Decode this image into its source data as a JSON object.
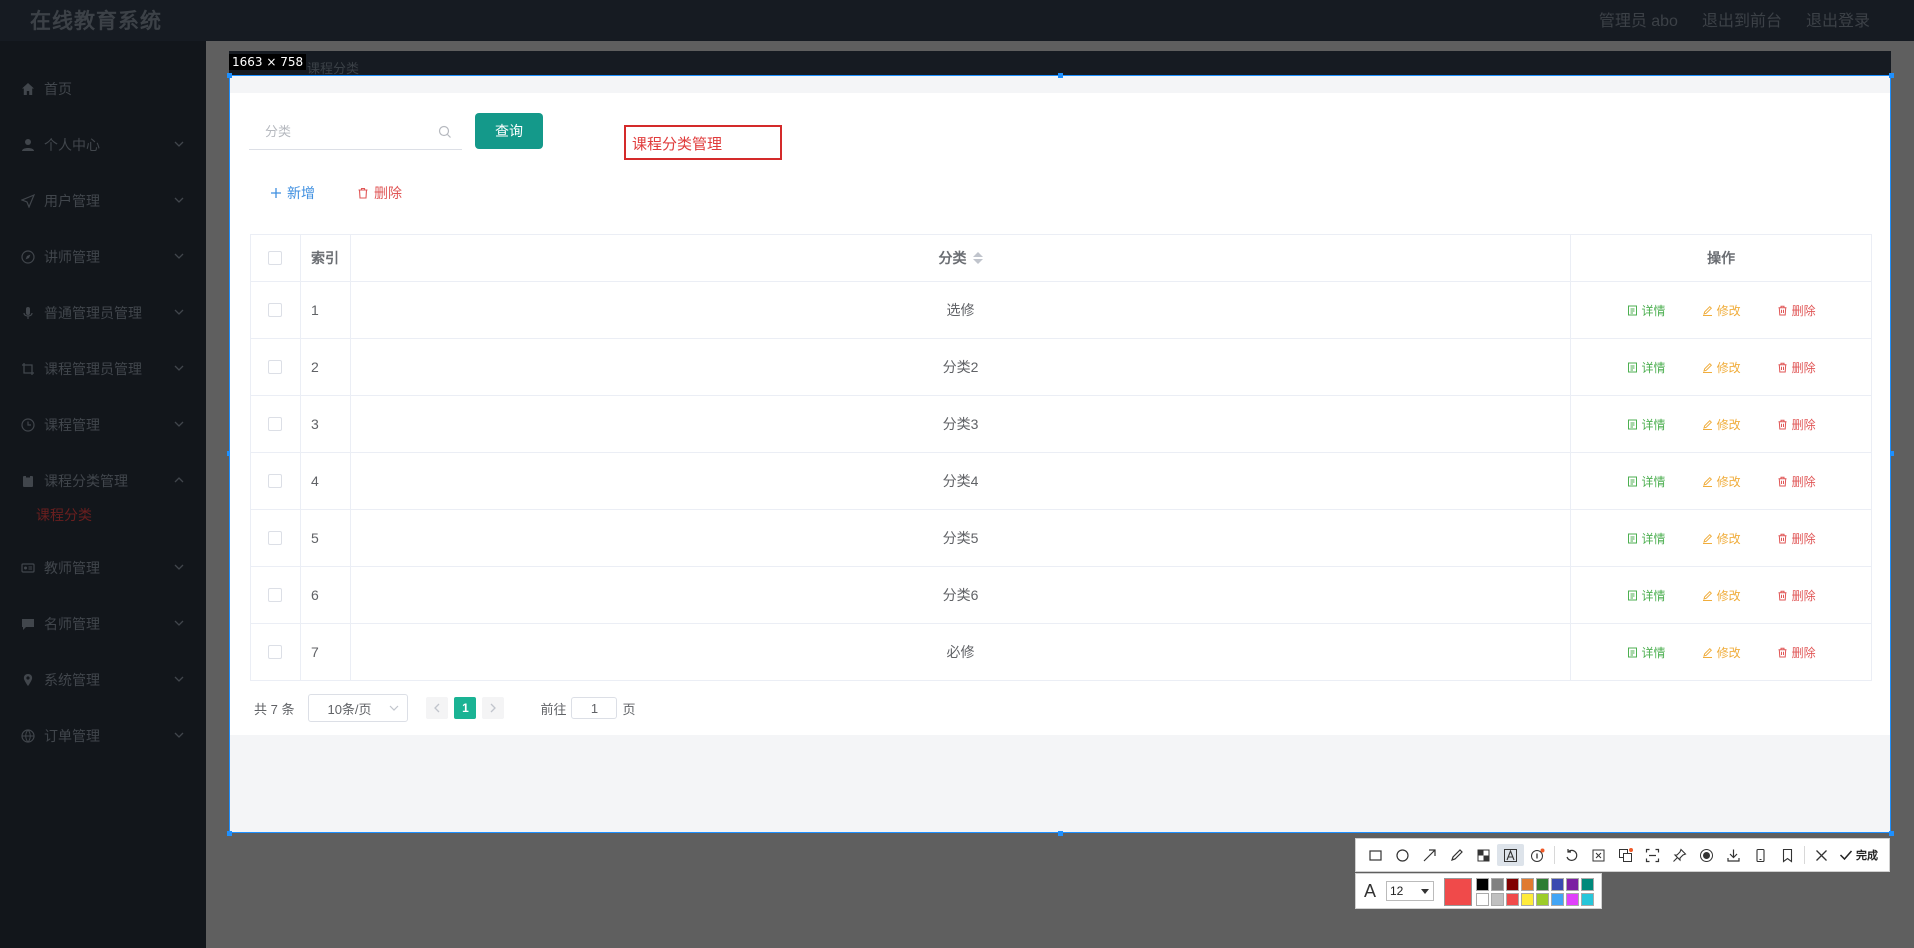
{
  "header": {
    "brand": "在线教育系统",
    "admin_label": "管理员 abo",
    "back_to_front": "退出到前台",
    "logout": "退出登录"
  },
  "sidebar": {
    "items": [
      {
        "label": "首页",
        "icon": "home-icon",
        "expandable": false
      },
      {
        "label": "个人中心",
        "icon": "user-icon",
        "expandable": true
      },
      {
        "label": "用户管理",
        "icon": "send-icon",
        "expandable": true
      },
      {
        "label": "讲师管理",
        "icon": "compass-icon",
        "expandable": true
      },
      {
        "label": "普通管理员管理",
        "icon": "microphone-icon",
        "expandable": true
      },
      {
        "label": "课程管理员管理",
        "icon": "crop-icon",
        "expandable": true
      },
      {
        "label": "课程管理",
        "icon": "clock-icon",
        "expandable": true
      },
      {
        "label": "课程分类管理",
        "icon": "clipboard-icon",
        "expandable": true,
        "open": true
      },
      {
        "label": "教师管理",
        "icon": "id-card-icon",
        "expandable": true
      },
      {
        "label": "名师管理",
        "icon": "chat-icon",
        "expandable": true
      },
      {
        "label": "系统管理",
        "icon": "location-icon",
        "expandable": true
      },
      {
        "label": "订单管理",
        "icon": "globe-icon",
        "expandable": true
      }
    ],
    "submenu_active": "课程分类"
  },
  "capture": {
    "dimensions": "1663 × 758",
    "breadcrumb": "课程分类"
  },
  "search": {
    "placeholder": "分类",
    "query_label": "查询"
  },
  "annotation_text": "课程分类管理",
  "actions": {
    "add_label": "新增",
    "delete_label": "删除"
  },
  "table": {
    "headers": {
      "index": "索引",
      "category": "分类",
      "ops": "操作"
    },
    "op_labels": {
      "detail": "详情",
      "edit": "修改",
      "delete": "删除"
    },
    "rows": [
      {
        "index": "1",
        "category": "选修"
      },
      {
        "index": "2",
        "category": "分类2"
      },
      {
        "index": "3",
        "category": "分类3"
      },
      {
        "index": "4",
        "category": "分类4"
      },
      {
        "index": "5",
        "category": "分类5"
      },
      {
        "index": "6",
        "category": "分类6"
      },
      {
        "index": "7",
        "category": "必修"
      }
    ]
  },
  "pagination": {
    "total": "共 7 条",
    "page_size": "10条/页",
    "current_page": "1",
    "goto_label": "前往",
    "goto_value": "1",
    "page_unit": "页"
  },
  "screenshot_tool": {
    "done_label": "完成",
    "font_size": "12",
    "current_color": "#f04a4a",
    "palette": [
      "#000000",
      "#808080",
      "#800000",
      "#e07a30",
      "#2e7d32",
      "#3a49b0",
      "#7b1fa2",
      "#00897b",
      "#ffffff",
      "#c0c0c0",
      "#f04a4a",
      "#ffeb3b",
      "#9ccc2a",
      "#42a5f5",
      "#e040fb",
      "#26c6da"
    ]
  }
}
